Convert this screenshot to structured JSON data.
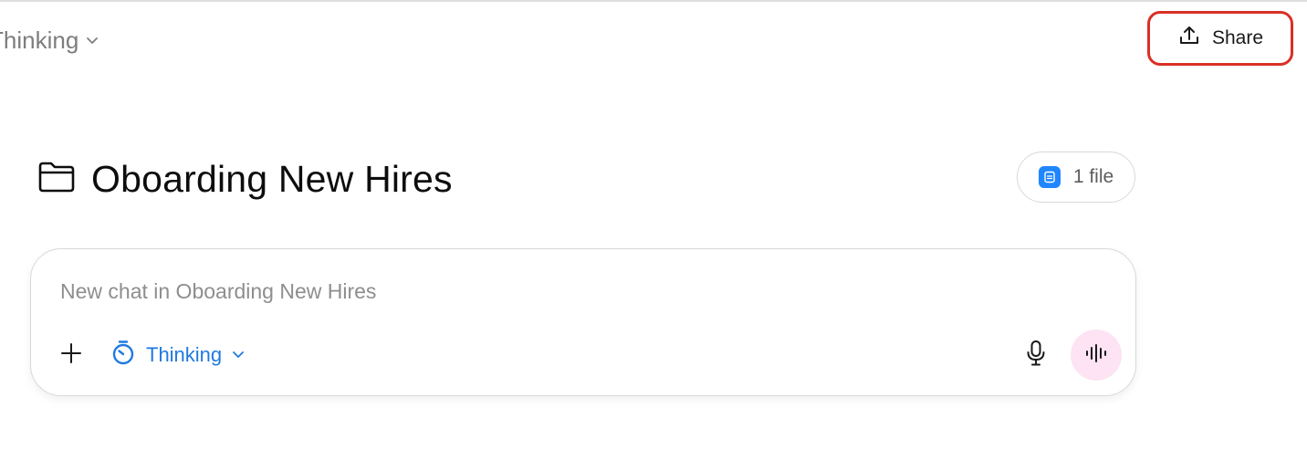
{
  "header": {
    "model_label": "Thinking",
    "share_label": "Share"
  },
  "project": {
    "title": "Oboarding New Hires",
    "files_label": "1 file"
  },
  "composer": {
    "placeholder": "New chat in Oboarding New Hires",
    "value": "",
    "mode_label": "Thinking"
  },
  "colors": {
    "share_highlight": "#d93025",
    "accent_blue": "#1f7ae0",
    "file_badge": "#1f86ff",
    "voice_button_bg": "#fde3f3"
  },
  "icons": {
    "model_chevron": "chevron-down-icon",
    "share": "upload-icon",
    "project": "folder-icon",
    "file": "document-icon",
    "add": "plus-icon",
    "mode": "timer-icon",
    "mode_chevron": "chevron-down-icon",
    "mic": "microphone-icon",
    "voice": "voice-waveform-icon"
  }
}
